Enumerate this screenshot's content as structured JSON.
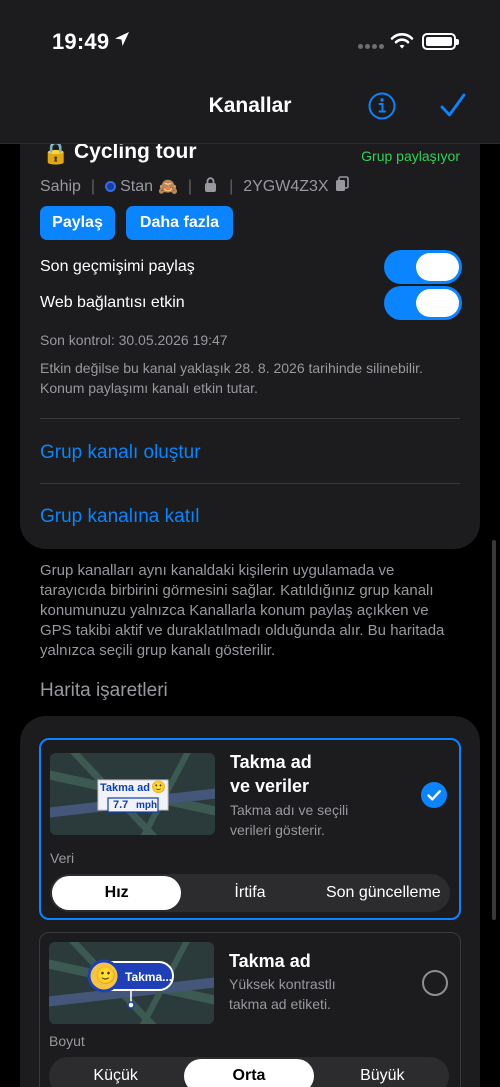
{
  "status": {
    "time": "19:49"
  },
  "nav": {
    "title": "Kanallar"
  },
  "channel": {
    "emoji": "🔒",
    "name": "Cycling tour",
    "share_status": "Grup paylaşıyor",
    "owner_label": "Sahip",
    "owner_name": "Stan",
    "owner_emoji": "🙈",
    "code": "2YGW4Z3X",
    "share_button": "Paylaş",
    "more_button": "Daha fazla",
    "toggle_history_label": "Son geçmişimi paylaş",
    "toggle_history_on": true,
    "toggle_web_label": "Web bağlantısı etkin",
    "toggle_web_on": true,
    "last_check": "Son kontrol: 30.05.2026 19:47",
    "expiry_info": "Etkin değilse bu kanal yaklaşık 28. 8. 2026 tarihinde silinebilir. Konum paylaşımı kanalı etkin tutar.",
    "create_group_link": "Grup kanalı oluştur",
    "join_group_link": "Grup kanalına katıl"
  },
  "footer": {
    "text": "Grup kanalları aynı kanaldaki kişilerin uygulamada ve tarayıcıda birbirini görmesini sağlar. Katıldığınız grup kanalı konumunuzu yalnızca Kanallarla konum paylaş açıkken ve GPS takibi aktif ve duraklatılmadı olduğunda alır. Bu haritada yalnızca seçili grup kanalı gösterilir."
  },
  "markers": {
    "section_title": "Harita işaretleri",
    "options": [
      {
        "title_line1": "Takma ad",
        "title_line2": "ve veriler",
        "desc_line1": "Takma adı ve seçili",
        "desc_line2": "verileri gösterir.",
        "selected": true,
        "preview_name": "Takma ad",
        "preview_emoji": "🙂",
        "preview_speed": "7.7",
        "preview_unit": "mph",
        "segment_label": "Veri",
        "segments": [
          "Hız",
          "İrtifa",
          "Son güncelleme"
        ],
        "active_segment": 0
      },
      {
        "title_line1": "Takma ad",
        "desc_line1": "Yüksek kontrastlı",
        "desc_line2": "takma ad etiketi.",
        "selected": false,
        "preview_name": "Takma...",
        "preview_emoji": "🙂",
        "segment_label": "Boyut",
        "segments": [
          "Küçük",
          "Orta",
          "Büyük"
        ],
        "active_segment": 1
      }
    ]
  },
  "colors": {
    "accent": "#0a84ff",
    "green": "#30d158",
    "card_bg": "#1c1c1e",
    "secondary_text": "#98989f"
  },
  "icons": {
    "nav_info": "info-circle-icon",
    "nav_done": "checkmark-icon",
    "copy": "copy-icon",
    "lock": "lock-icon"
  }
}
